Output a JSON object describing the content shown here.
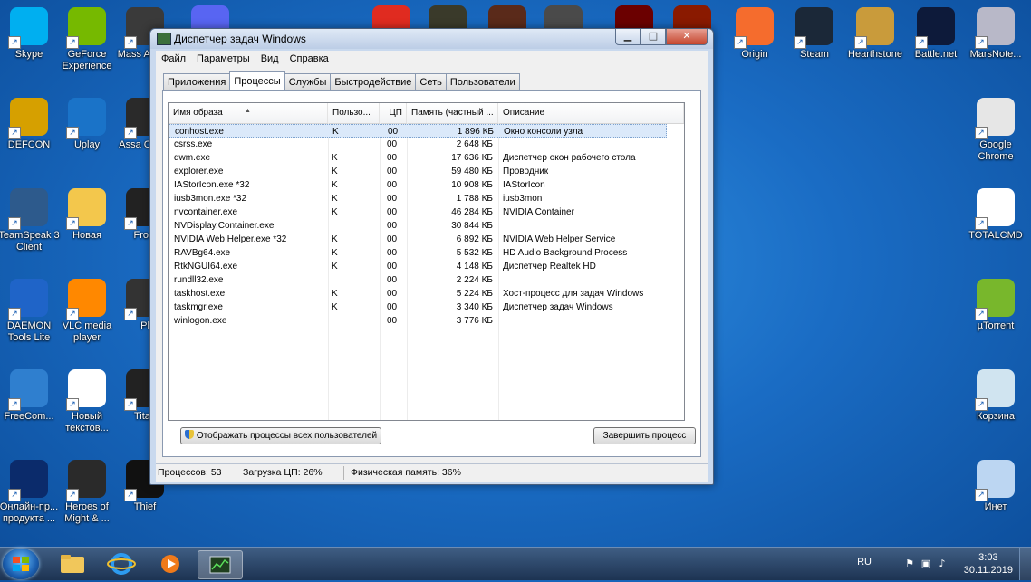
{
  "desktop": {
    "icons_left": [
      {
        "label": "Skype",
        "color": "#00aff0"
      },
      {
        "label": "GeForce Experience",
        "color": "#76b900"
      },
      {
        "label": "Mass Androi",
        "color": "#3a3a3a"
      },
      {
        "label": "DEFCON",
        "color": "#d6a000"
      },
      {
        "label": "Uplay",
        "color": "#1a73c8"
      },
      {
        "label": "Assa Creed",
        "color": "#2a2a2a"
      },
      {
        "label": "TeamSpeak 3 Client",
        "color": "#2d5a8c"
      },
      {
        "label": "Новая",
        "color": "#f3c74c"
      },
      {
        "label": "Frost",
        "color": "#222222"
      },
      {
        "label": "DAEMON Tools Lite",
        "color": "#1f64c8"
      },
      {
        "label": "VLC media player",
        "color": "#ff8800"
      },
      {
        "label": "Pl",
        "color": "#333333"
      },
      {
        "label": "FreeCom...",
        "color": "#2f7fcf"
      },
      {
        "label": "Новый текстов...",
        "color": "#ffffff"
      },
      {
        "label": "Titan",
        "color": "#222222"
      },
      {
        "label": "Онлайн-пр... продукта ...",
        "color": "#0b2b6b"
      },
      {
        "label": "Heroes of Might & ...",
        "color": "#2a2a2a"
      },
      {
        "label": "Thief",
        "color": "#111111"
      }
    ],
    "icons_top": [
      {
        "label": "",
        "color": "#5865f2"
      },
      {
        "label": "",
        "color": "#e02b20"
      },
      {
        "label": "",
        "color": "#3a3a2a"
      },
      {
        "label": "",
        "color": "#5a2a1a"
      },
      {
        "label": "",
        "color": "#4a4a4a"
      },
      {
        "label": "",
        "color": "#6b0000"
      },
      {
        "label": "",
        "color": "#8a1a00"
      }
    ],
    "icons_right": [
      {
        "label": "Origin",
        "color": "#f56c2d"
      },
      {
        "label": "Steam",
        "color": "#1b2838"
      },
      {
        "label": "Hearthstone",
        "color": "#c99b3b"
      },
      {
        "label": "Battle.net",
        "color": "#0d1a3a"
      },
      {
        "label": "MarsNote...",
        "color": "#b8b8c8"
      },
      {
        "label": "Google Chrome",
        "color": "#e6e6e6"
      },
      {
        "label": "TOTALCMD",
        "color": "#ffffff"
      },
      {
        "label": "µTorrent",
        "color": "#78b72c"
      },
      {
        "label": "Корзина",
        "color": "#d0e4f0"
      },
      {
        "label": "Инет",
        "color": "#bcd6f2"
      }
    ]
  },
  "window": {
    "title": "Диспетчер задач Windows",
    "controls": {
      "minimize": "▁",
      "maximize": "□",
      "close": "✕"
    },
    "menu": [
      "Файл",
      "Параметры",
      "Вид",
      "Справка"
    ],
    "tabs": [
      "Приложения",
      "Процессы",
      "Службы",
      "Быстродействие",
      "Сеть",
      "Пользователи"
    ],
    "active_tab": 1,
    "columns": [
      "Имя образа",
      "Пользо...",
      "ЦП",
      "Память (частный ...",
      "Описание"
    ],
    "rows": [
      {
        "name": "conhost.exe",
        "user": "K",
        "cpu": "00",
        "mem": "1 896 КБ",
        "desc": "Окно консоли узла"
      },
      {
        "name": "csrss.exe",
        "user": "",
        "cpu": "00",
        "mem": "2 648 КБ",
        "desc": ""
      },
      {
        "name": "dwm.exe",
        "user": "K",
        "cpu": "00",
        "mem": "17 636 КБ",
        "desc": "Диспетчер окон рабочего стола"
      },
      {
        "name": "explorer.exe",
        "user": "K",
        "cpu": "00",
        "mem": "59 480 КБ",
        "desc": "Проводник"
      },
      {
        "name": "IAStorIcon.exe *32",
        "user": "K",
        "cpu": "00",
        "mem": "10 908 КБ",
        "desc": "IAStorIcon"
      },
      {
        "name": "iusb3mon.exe *32",
        "user": "K",
        "cpu": "00",
        "mem": "1 788 КБ",
        "desc": "iusb3mon"
      },
      {
        "name": "nvcontainer.exe",
        "user": "K",
        "cpu": "00",
        "mem": "46 284 КБ",
        "desc": "NVIDIA Container"
      },
      {
        "name": "NVDisplay.Container.exe",
        "user": "",
        "cpu": "00",
        "mem": "30 844 КБ",
        "desc": ""
      },
      {
        "name": "NVIDIA Web Helper.exe *32",
        "user": "K",
        "cpu": "00",
        "mem": "6 892 КБ",
        "desc": "NVIDIA Web Helper Service"
      },
      {
        "name": "RAVBg64.exe",
        "user": "K",
        "cpu": "00",
        "mem": "5 532 КБ",
        "desc": "HD Audio Background Process"
      },
      {
        "name": "RtkNGUI64.exe",
        "user": "K",
        "cpu": "00",
        "mem": "4 148 КБ",
        "desc": "Диспетчер Realtek HD"
      },
      {
        "name": "rundll32.exe",
        "user": "",
        "cpu": "00",
        "mem": "2 224 КБ",
        "desc": ""
      },
      {
        "name": "taskhost.exe",
        "user": "K",
        "cpu": "00",
        "mem": "5 224 КБ",
        "desc": "Хост-процесс для задач Windows"
      },
      {
        "name": "taskmgr.exe",
        "user": "K",
        "cpu": "00",
        "mem": "3 340 КБ",
        "desc": "Диспетчер задач Windows"
      },
      {
        "name": "winlogon.exe",
        "user": "",
        "cpu": "00",
        "mem": "3 776 КБ",
        "desc": ""
      }
    ],
    "show_all_button": "Отображать процессы всех пользователей",
    "end_process_button": "Завершить процесс",
    "status": {
      "processes": "Процессов: 53",
      "cpu": "Загрузка ЦП: 26%",
      "memory": "Физическая память: 36%"
    }
  },
  "taskbar": {
    "language": "RU",
    "time": "3:03",
    "date": "30.11.2019"
  }
}
